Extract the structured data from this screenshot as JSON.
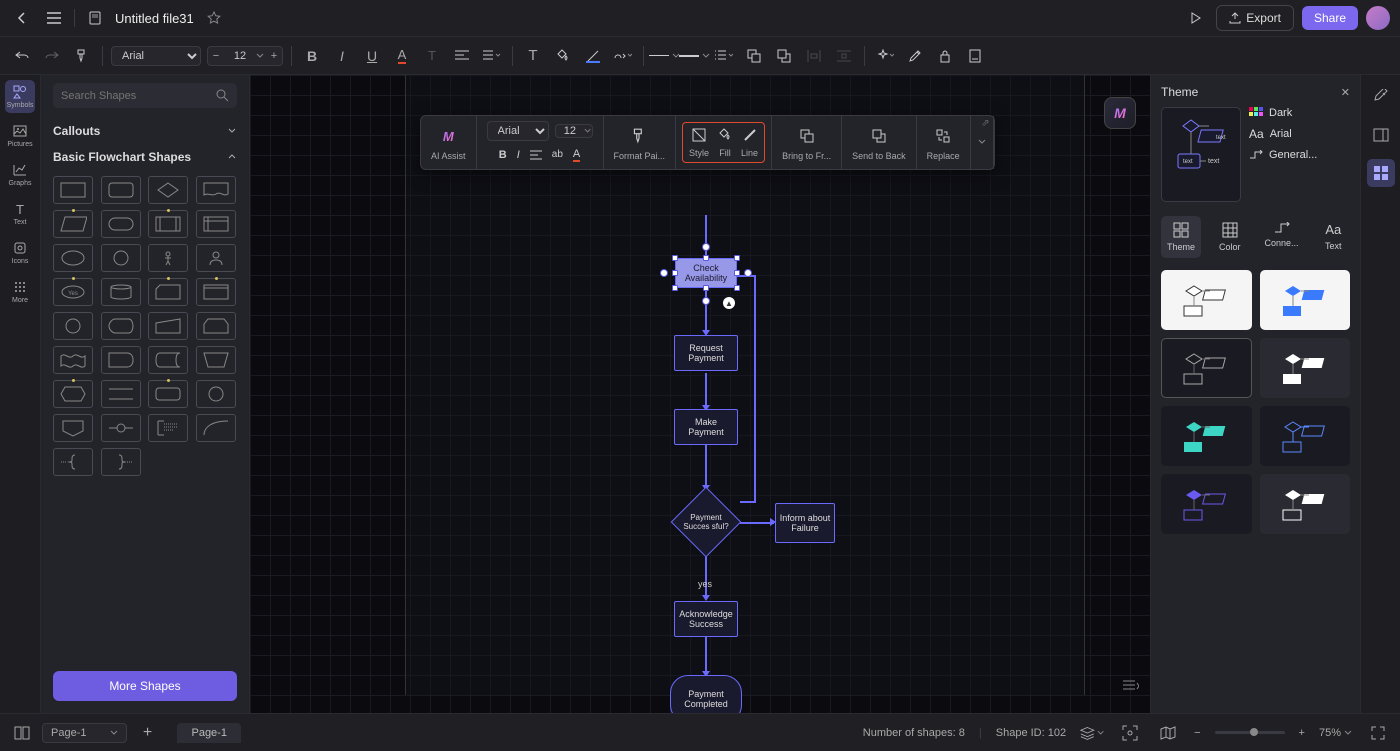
{
  "header": {
    "filename": "Untitled file31",
    "export": "Export",
    "share": "Share"
  },
  "toolbar": {
    "font": "Arial",
    "fontSize": "12"
  },
  "leftRail": [
    {
      "label": "Symbols",
      "active": true
    },
    {
      "label": "Pictures"
    },
    {
      "label": "Graphs"
    },
    {
      "label": "Text"
    },
    {
      "label": "Icons"
    },
    {
      "label": "More"
    }
  ],
  "shapes": {
    "searchPlaceholder": "Search Shapes",
    "categories": [
      {
        "name": "Callouts",
        "open": false
      },
      {
        "name": "Basic Flowchart Shapes",
        "open": true
      }
    ],
    "moreBtn": "More Shapes"
  },
  "flowchart": {
    "n1": "Check Availability",
    "n2": "Request Payment",
    "n3": "Make Payment",
    "n4": "Payment Succes sful?",
    "n5": "Inform about Failure",
    "n6": "Acknowledge Success",
    "n7": "Payment Completed",
    "yesLabel": "yes"
  },
  "contextBar": {
    "aiAssist": "AI Assist",
    "font": "Arial",
    "size": "12",
    "formatPainter": "Format Pai...",
    "style": "Style",
    "fill": "Fill",
    "line": "Line",
    "bringFront": "Bring to Fr...",
    "sendBack": "Send to Back",
    "replace": "Replace"
  },
  "rightPanel": {
    "title": "Theme",
    "dark": "Dark",
    "font": "Arial",
    "connector": "General...",
    "previewText": "text",
    "tabs": [
      "Theme",
      "Color",
      "Conne...",
      "Text"
    ]
  },
  "bottom": {
    "pageSel": "Page-1",
    "pageTab": "Page-1",
    "shapesCount": "Number of shapes: 8",
    "shapeId": "Shape ID: 102",
    "zoom": "75%"
  }
}
